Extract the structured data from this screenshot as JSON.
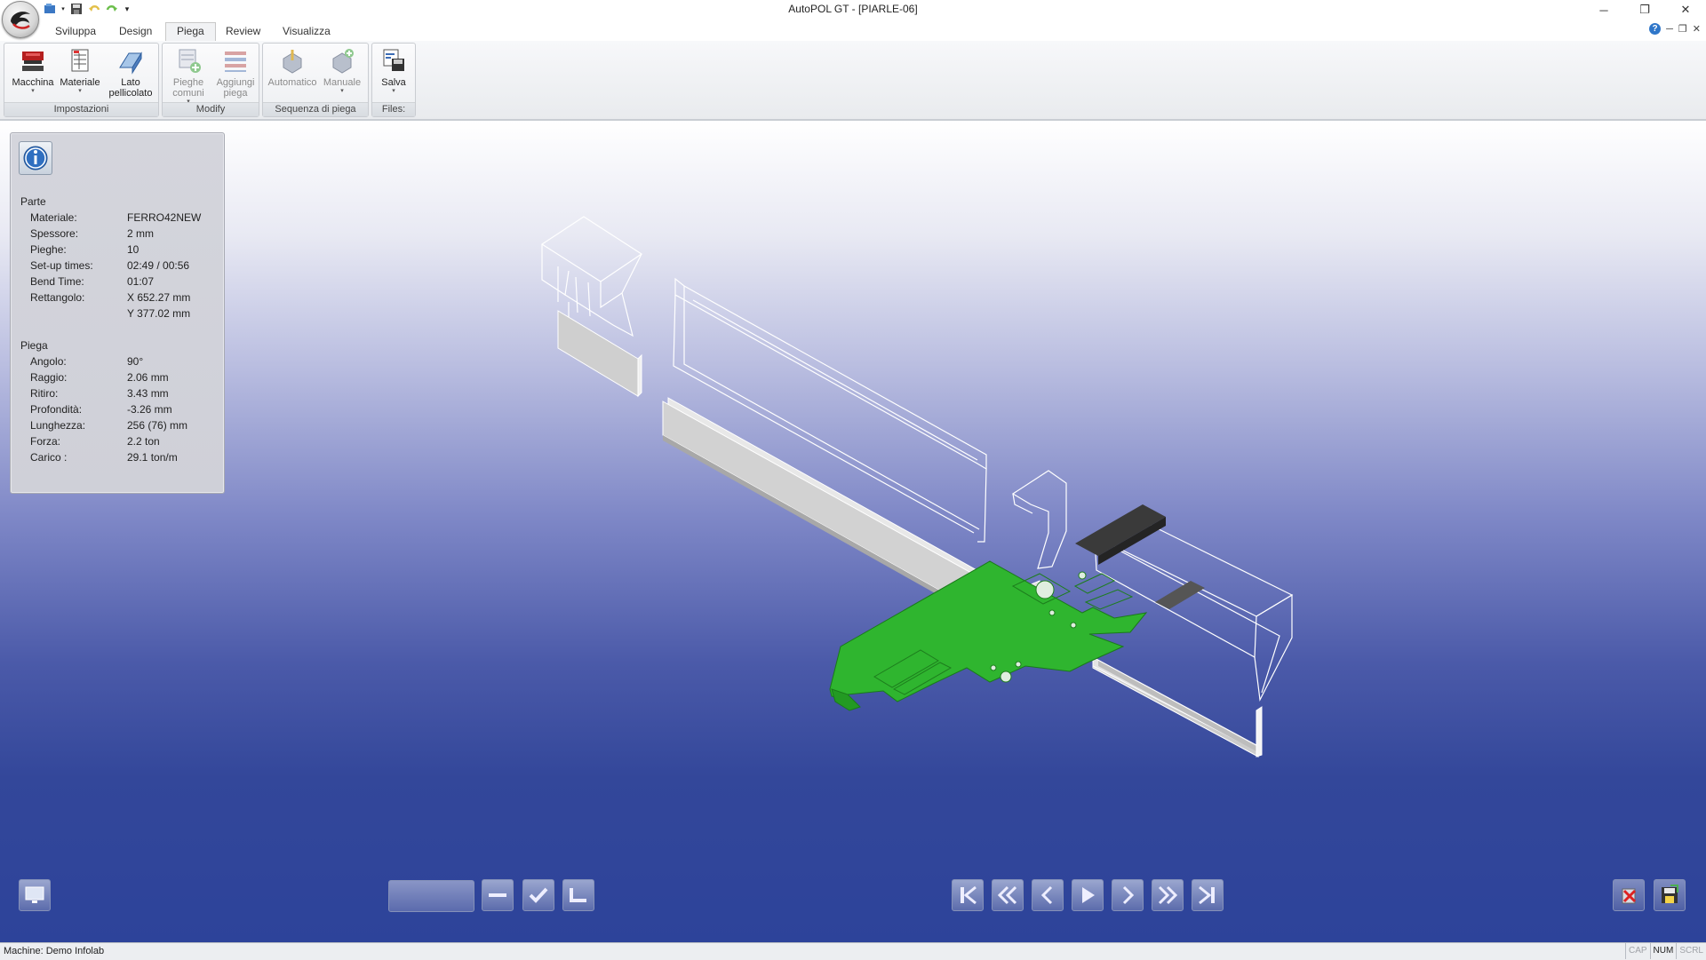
{
  "window": {
    "title": "AutoPOL GT - [PIARLE-06]",
    "controls": {
      "minimize": "─",
      "restore": "❐",
      "close": "✕"
    }
  },
  "tabs": [
    {
      "label": "Sviluppa",
      "active": false
    },
    {
      "label": "Design",
      "active": false
    },
    {
      "label": "Piega",
      "active": true
    },
    {
      "label": "Review",
      "active": false
    },
    {
      "label": "Visualizza",
      "active": false
    }
  ],
  "ribbon": {
    "groups": [
      {
        "label": "Impostazioni",
        "buttons": [
          {
            "label": "Macchina",
            "icon": "press-brake-icon",
            "dropdown": true,
            "enabled": true
          },
          {
            "label": "Materiale",
            "icon": "material-table-icon",
            "dropdown": true,
            "enabled": true
          },
          {
            "label": "Lato pellicolato",
            "icon": "film-side-icon",
            "dropdown": false,
            "enabled": true
          }
        ]
      },
      {
        "label": "Modify",
        "buttons": [
          {
            "label": "Pieghe comuni",
            "icon": "common-bends-icon",
            "dropdown": true,
            "enabled": false
          },
          {
            "label": "Aggiungi piega",
            "icon": "add-bend-icon",
            "dropdown": false,
            "enabled": false
          }
        ]
      },
      {
        "label": "Sequenza di piega",
        "buttons": [
          {
            "label": "Automatico",
            "icon": "automatic-sequence-icon",
            "dropdown": false,
            "enabled": false
          },
          {
            "label": "Manuale",
            "icon": "manual-sequence-icon",
            "dropdown": true,
            "enabled": false
          }
        ]
      },
      {
        "label": "Files:",
        "buttons": [
          {
            "label": "Salva",
            "icon": "save-file-icon",
            "dropdown": true,
            "enabled": true
          }
        ]
      }
    ]
  },
  "info_panel": {
    "part": {
      "title": "Parte",
      "rows": [
        {
          "label": "Materiale:",
          "value": "FERRO42NEW"
        },
        {
          "label": "Spessore:",
          "value": "2 mm"
        },
        {
          "label": "Pieghe:",
          "value": "10"
        },
        {
          "label": "Set-up times:",
          "value": "02:49 / 00:56"
        },
        {
          "label": "Bend Time:",
          "value": "01:07"
        },
        {
          "label": "Rettangolo:",
          "value": "X 652.27 mm"
        },
        {
          "label": "",
          "value": "Y 377.02 mm"
        }
      ]
    },
    "bend": {
      "title": "Piega",
      "rows": [
        {
          "label": "Angolo:",
          "value": "90°"
        },
        {
          "label": "Raggio:",
          "value": "2.06 mm"
        },
        {
          "label": "Ritiro:",
          "value": "3.43 mm"
        },
        {
          "label": "Profondità:",
          "value": "-3.26 mm"
        },
        {
          "label": "Lunghezza:",
          "value": "256 (76) mm"
        },
        {
          "label": "Forza:",
          "value": "2.2 ton"
        },
        {
          "label": "Carico  :",
          "value": "29.1 ton/m"
        }
      ]
    }
  },
  "colors": {
    "part_green": "#2fb52f",
    "accent_blue": "#2d439a"
  },
  "status": {
    "machine": "Machine: Demo Infolab",
    "indicators": [
      {
        "label": "CAP",
        "on": false
      },
      {
        "label": "NUM",
        "on": true
      },
      {
        "label": "SCRL",
        "on": false
      }
    ]
  }
}
